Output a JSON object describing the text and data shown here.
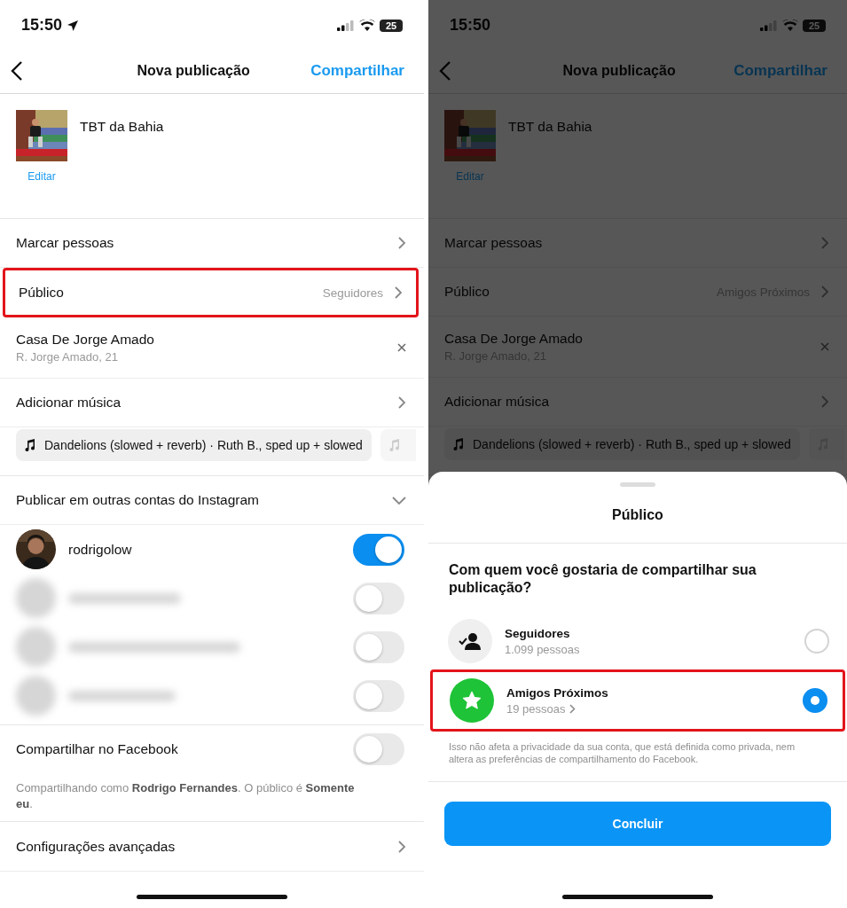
{
  "screens": [
    {
      "dimmed": false,
      "status_bar": {
        "time": "15:50",
        "location_arrow": true,
        "battery": "25"
      },
      "header": {
        "title": "Nova publicação",
        "action": "Compartilhar"
      },
      "post": {
        "caption": "TBT da Bahia",
        "edit": "Editar"
      },
      "rows": [
        {
          "kind": "link",
          "label": "Marcar pessoas",
          "highlighted": false
        },
        {
          "kind": "link",
          "label": "Público",
          "value": "Seguidores",
          "highlighted": true
        },
        {
          "kind": "location",
          "label": "Casa De Jorge Amado",
          "sublabel": "R. Jorge Amado, 21",
          "highlighted": false
        },
        {
          "kind": "link",
          "label": "Adicionar música",
          "highlighted": false
        }
      ],
      "music": {
        "track": "Dandelions (slowed + reverb) · Ruth B., sped up + slowed",
        "more": true
      },
      "accounts_section": {
        "title": "Publicar em outras contas do Instagram",
        "expanded": true,
        "accounts": [
          {
            "name": "rodrigolow",
            "blurred": false,
            "on": true
          },
          {
            "blurred": true,
            "on": false
          },
          {
            "blurred": true,
            "on": false
          },
          {
            "blurred": true,
            "on": false
          }
        ]
      },
      "facebook": {
        "label": "Compartilhar no Facebook",
        "on": false,
        "note": "Compartilhando como **Rodrigo Fernandes**. O público é **Somente eu**."
      },
      "advanced": {
        "label": "Configurações avançadas"
      }
    },
    {
      "dimmed": true,
      "status_bar": {
        "time": "15:50",
        "location_arrow": false,
        "battery": "25"
      },
      "header": {
        "title": "Nova publicação",
        "action": "Compartilhar"
      },
      "post": {
        "caption": "TBT da Bahia",
        "edit": "Editar"
      },
      "rows": [
        {
          "kind": "link",
          "label": "Marcar pessoas",
          "highlighted": false
        },
        {
          "kind": "link",
          "label": "Público",
          "value": "Amigos Próximos",
          "highlighted": false
        },
        {
          "kind": "location",
          "label": "Casa De Jorge Amado",
          "sublabel": "R. Jorge Amado, 21",
          "highlighted": false
        },
        {
          "kind": "link",
          "label": "Adicionar música",
          "highlighted": false
        }
      ],
      "music": {
        "track": "Dandelions (slowed + reverb) · Ruth B., sped up + slowed",
        "more": true
      },
      "sheet": {
        "title": "Público",
        "question": "Com quem você gostaria de compartilhar sua publicação?",
        "options": [
          {
            "kind": "followers",
            "label": "Seguidores",
            "sublabel": "1.099 pessoas",
            "has_chevron": false,
            "selected": false,
            "highlighted": false
          },
          {
            "kind": "close_friends",
            "label": "Amigos Próximos",
            "sublabel": "19 pessoas",
            "has_chevron": true,
            "selected": true,
            "highlighted": true
          }
        ],
        "note": "Isso não afeta a privacidade da sua conta, que está definida como privada, nem altera as preferências de compartilhamento do Facebook.",
        "button": "Concluir"
      }
    }
  ]
}
